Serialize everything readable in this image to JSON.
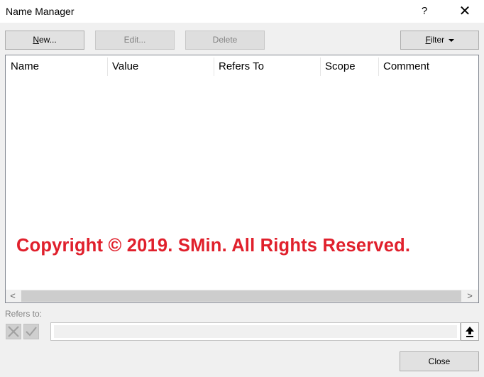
{
  "window": {
    "title": "Name Manager",
    "help_label": "?",
    "close_label": "✕"
  },
  "toolbar": {
    "new_label": "New...",
    "edit_label": "Edit...",
    "delete_label": "Delete",
    "filter_label": "Filter"
  },
  "list": {
    "columns": [
      "Name",
      "Value",
      "Refers To",
      "Scope",
      "Comment"
    ],
    "rows": []
  },
  "watermark": "Copyright © 2019. SMin. All Rights Reserved.",
  "scroll": {
    "left_arrow": "<",
    "right_arrow": ">"
  },
  "refers_to": {
    "label": "Refers to:",
    "value": ""
  },
  "footer": {
    "close_label": "Close"
  },
  "colors": {
    "watermark": "#e0202c",
    "dialog_bg": "#f0f0f0",
    "disabled_text": "#838383"
  }
}
